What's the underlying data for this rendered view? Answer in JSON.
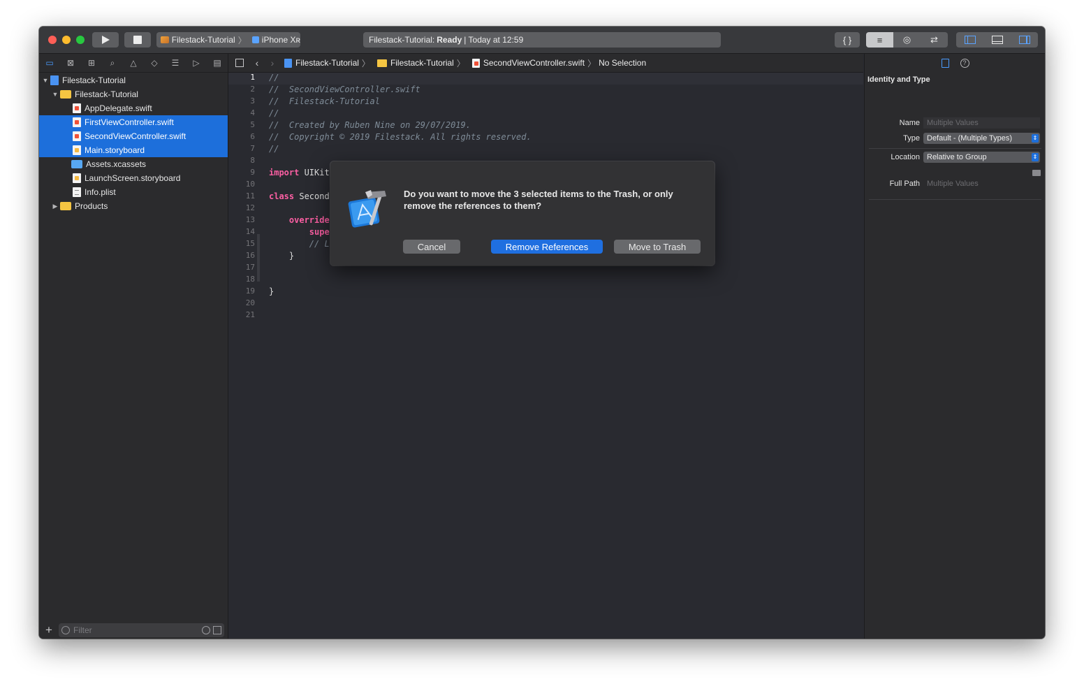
{
  "toolbar": {
    "scheme_project": "Filestack-Tutorial",
    "scheme_device": "iPhone Xʀ",
    "activity_project": "Filestack-Tutorial:",
    "activity_status": "Ready",
    "activity_time": "| Today at 12:59",
    "code_snippet_label": "{ }",
    "editor_mode_standard": "≡",
    "editor_mode_assistant": "◎",
    "editor_mode_version": "⇄"
  },
  "navigator": {
    "tabs": [
      "folder-icon",
      "source-control-icon",
      "symbol-icon",
      "search-icon",
      "warning-icon",
      "test-icon",
      "debug-icon",
      "breakpoint-icon",
      "report-icon"
    ],
    "tree": [
      {
        "label": "Filestack-Tutorial",
        "level": 0,
        "icon": "project",
        "expanded": true,
        "selected": false
      },
      {
        "label": "Filestack-Tutorial",
        "level": 1,
        "icon": "folder",
        "expanded": true,
        "selected": false
      },
      {
        "label": "AppDelegate.swift",
        "level": 2,
        "icon": "swift",
        "selected": false
      },
      {
        "label": "FirstViewController.swift",
        "level": 2,
        "icon": "swift",
        "selected": true
      },
      {
        "label": "SecondViewController.swift",
        "level": 2,
        "icon": "swift",
        "selected": true
      },
      {
        "label": "Main.storyboard",
        "level": 2,
        "icon": "storyboard",
        "selected": true
      },
      {
        "label": "Assets.xcassets",
        "level": 2,
        "icon": "assets",
        "selected": false
      },
      {
        "label": "LaunchScreen.storyboard",
        "level": 2,
        "icon": "storyboard",
        "selected": false
      },
      {
        "label": "Info.plist",
        "level": 2,
        "icon": "plist",
        "selected": false
      },
      {
        "label": "Products",
        "level": 1,
        "icon": "folder",
        "expanded": false,
        "selected": false
      }
    ],
    "filter_placeholder": "Filter"
  },
  "jumpbar": {
    "project": "Filestack-Tutorial",
    "group": "Filestack-Tutorial",
    "file": "SecondViewController.swift",
    "selection": "No Selection"
  },
  "code": {
    "current_line": 1,
    "lines": [
      {
        "n": "1",
        "text": "//",
        "type": "comment"
      },
      {
        "n": "2",
        "text": "//  SecondViewController.swift",
        "type": "comment"
      },
      {
        "n": "3",
        "text": "//  Filestack-Tutorial",
        "type": "comment"
      },
      {
        "n": "4",
        "text": "//",
        "type": "comment"
      },
      {
        "n": "5",
        "text": "//  Created by Ruben Nine on 29/07/2019.",
        "type": "comment"
      },
      {
        "n": "6",
        "text": "//  Copyright © 2019 Filestack. All rights reserved.",
        "type": "comment"
      },
      {
        "n": "7",
        "text": "//",
        "type": "comment"
      },
      {
        "n": "8",
        "text": "",
        "type": "plain"
      },
      {
        "n": "9",
        "kw": "import",
        "text": " UIKit",
        "type": "kw"
      },
      {
        "n": "10",
        "text": "",
        "type": "plain"
      },
      {
        "n": "11",
        "kw": "class",
        "text": " Second",
        "type": "kw"
      },
      {
        "n": "12",
        "text": "",
        "type": "plain"
      },
      {
        "n": "13",
        "kw": "    override",
        "text": "",
        "type": "kw"
      },
      {
        "n": "14",
        "kw": "        supe",
        "text": "",
        "type": "kw"
      },
      {
        "n": "15",
        "text": "        // L",
        "type": "comment"
      },
      {
        "n": "16",
        "text": "    }",
        "type": "plain"
      },
      {
        "n": "17",
        "text": "",
        "type": "plain"
      },
      {
        "n": "18",
        "text": "",
        "type": "plain"
      },
      {
        "n": "19",
        "text": "}",
        "type": "plain"
      },
      {
        "n": "20",
        "text": "",
        "type": "plain"
      },
      {
        "n": "21",
        "text": "",
        "type": "plain"
      }
    ]
  },
  "inspector": {
    "section_title": "Identity and Type",
    "name_label": "Name",
    "name_value": "Multiple Values",
    "type_label": "Type",
    "type_value": "Default - (Multiple Types)",
    "location_label": "Location",
    "location_value": "Relative to Group",
    "fullpath_label": "Full Path",
    "fullpath_value": "Multiple Values"
  },
  "dialog": {
    "message_line1": "Do you want to move the 3 selected items to the Trash, or only",
    "message_line2": "remove the references to them?",
    "cancel_label": "Cancel",
    "remove_label": "Remove References",
    "trash_label": "Move to Trash"
  },
  "colors": {
    "selection": "#1d6fdb",
    "primary_button": "#1f6fe0",
    "keyword": "#fc5fa3",
    "comment": "#7f8c98"
  }
}
